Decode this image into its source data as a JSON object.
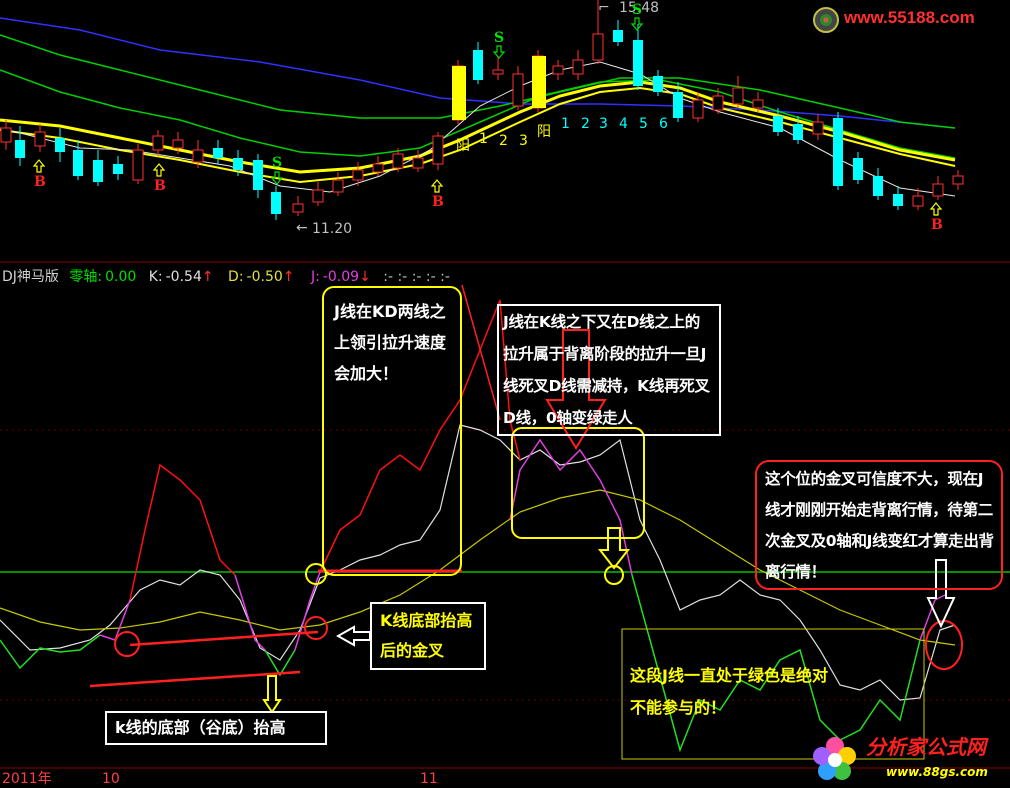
{
  "watermark_top": {
    "text": "www.55188.com"
  },
  "watermark_bottom": {
    "brand": "分析家公式网",
    "url": "www.88gs.com"
  },
  "price_labels": {
    "high": "15.48",
    "low": "11.20"
  },
  "markers": {
    "buy": "B",
    "sell": "S"
  },
  "wave_numbers": {
    "yang_label": "阳",
    "yin_label": "阴",
    "yin_counts": [
      "1",
      "2",
      "3"
    ],
    "yang_counts": [
      "1",
      "2",
      "3",
      "4",
      "5",
      "6"
    ]
  },
  "indicator_header": {
    "name": "DJ神马版",
    "zero_label": "零轴:",
    "zero_value": "0.00",
    "k_label": "K:",
    "k_value": "-0.54",
    "d_label": "D:",
    "d_value": "-0.50",
    "j_label": "J:",
    "j_value": "-0.09",
    "trail": ":- :- :- :- :-",
    "up_arrow": "↑",
    "down_arrow": "↓"
  },
  "time_axis": {
    "labels": [
      "2011年",
      "10",
      "11"
    ]
  },
  "annotations": {
    "a1": "J线在KD两线之上领引拉升速度会加大！",
    "a2": "J线在K线之下又在D线之上的拉升属于背离阶段的拉升一旦J线死叉D线需减持，K线再死叉D线，0轴变绿走人",
    "a3": "K线底部抬高后的金叉",
    "a4": "k线的底部（谷底）抬高",
    "a5": "这段J线一直处于绿色是绝对不能参与的！",
    "a6": "这个位的金叉可信度不大，现在J线才刚刚开始走背离行情，待第二次金叉及0轴和J线变红才算走出背离行情！"
  },
  "colors": {
    "up": "#ff3030",
    "down": "#00ffff",
    "ma_white": "#e8e8e8",
    "ma_yellow": "#ffff00",
    "ma_green": "#00d000",
    "ma_blue": "#3030ff",
    "k_line": "#e0e0e0",
    "d_line": "#c8c800",
    "j_red": "#ff1010",
    "j_magenta": "#e040e0",
    "j_green": "#20e020",
    "zero_axis": "#00c000"
  },
  "chart_data": [
    {
      "type": "candlestick",
      "title": "",
      "price_extremes": {
        "high": 15.48,
        "low": 11.2
      }
    },
    {
      "type": "line",
      "title": "DJ神马版",
      "series": [
        {
          "name": "K",
          "last": -0.54
        },
        {
          "name": "D",
          "last": -0.5
        },
        {
          "name": "J",
          "last": -0.09
        }
      ],
      "zero_axis": 0.0
    }
  ]
}
